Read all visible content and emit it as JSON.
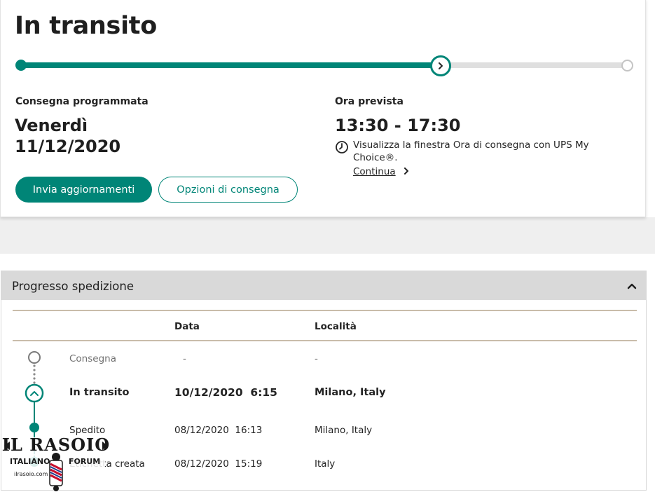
{
  "status": {
    "title": "In transito",
    "progress_fraction": 0.69
  },
  "delivery": {
    "scheduled_label": "Consegna programmata",
    "scheduled_day": "Venerdì",
    "scheduled_date": "11/12/2020",
    "eta_label": "Ora prevista",
    "eta_window": "13:30 - 17:30",
    "eta_info": "Visualizza la finestra Ora di consegna con UPS My Choice®.",
    "eta_link": "Continua"
  },
  "actions": {
    "primary": "Invia aggiornamenti",
    "secondary": "Opzioni di consegna"
  },
  "progress_panel": {
    "title": "Progresso spedizione",
    "columns": [
      "Data",
      "Località"
    ],
    "rows": [
      {
        "status": "Consegna",
        "date": "-",
        "location": "-"
      },
      {
        "status": "In transito",
        "date": "10/12/2020",
        "time": "6:15",
        "location": "Milano, Italy"
      },
      {
        "status": "Spedito",
        "date": "08/12/2020",
        "time": "16:13",
        "location": "Milano, Italy"
      },
      {
        "status": "Etichetta creata",
        "date": "08/12/2020",
        "time": "15:19",
        "location": "Italy"
      }
    ]
  },
  "watermark": {
    "top": "IL RASOIO",
    "left": "ITALIANO",
    "right": "FORUM",
    "bottom": "ilrasoio.com"
  },
  "colors": {
    "accent": "#008577",
    "track_empty": "#dfdfdf",
    "header_bg": "#d9d9d9",
    "rule": "#c9bcaa"
  },
  "icons": {
    "current_step": "chevron-right-icon",
    "eta": "clock-icon",
    "link": "chevron-right-icon",
    "collapse": "chevron-up-icon",
    "timeline_current": "chevron-up-icon"
  }
}
